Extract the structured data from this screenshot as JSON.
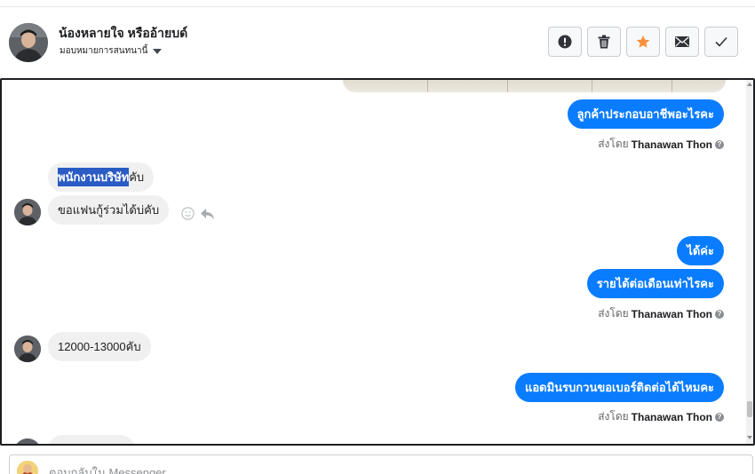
{
  "header": {
    "contact_name": "น้องหลายใจ หรืออ้ายบด์",
    "assign_label": "มอบหมายการสนทนานี้",
    "actions": [
      {
        "icon": "alert-icon"
      },
      {
        "icon": "trash-icon"
      },
      {
        "icon": "star-icon"
      },
      {
        "icon": "mail-icon"
      },
      {
        "icon": "check-icon"
      }
    ]
  },
  "colors": {
    "outgoing_bubble": "#0a7cff",
    "incoming_bubble": "#f0f0f0",
    "star": "#f7923a",
    "selection": "#2b5cc4"
  },
  "thread": {
    "msg1": "ลูกค้าประกอบอาชีพอะไรคะ",
    "sent_by_prefix": "ส่งโดย",
    "agent_name": "Thanawan Thon",
    "in1_selected": "พนักงานบริษัท",
    "in1_rest": "คับ",
    "in2": "ขอแฟนกู้ร่วมได้บ่คับ",
    "msg2": "ได้ค่ะ",
    "msg3": "รายได้ต่อเดือนเท่าไรคะ",
    "in3": "12000-13000คับ",
    "msg4": "แอดมินรบกวนขอเบอร์ติดต่อได้ไหมคะ"
  },
  "composer": {
    "placeholder": "ตอบกลับใน Messenger"
  }
}
